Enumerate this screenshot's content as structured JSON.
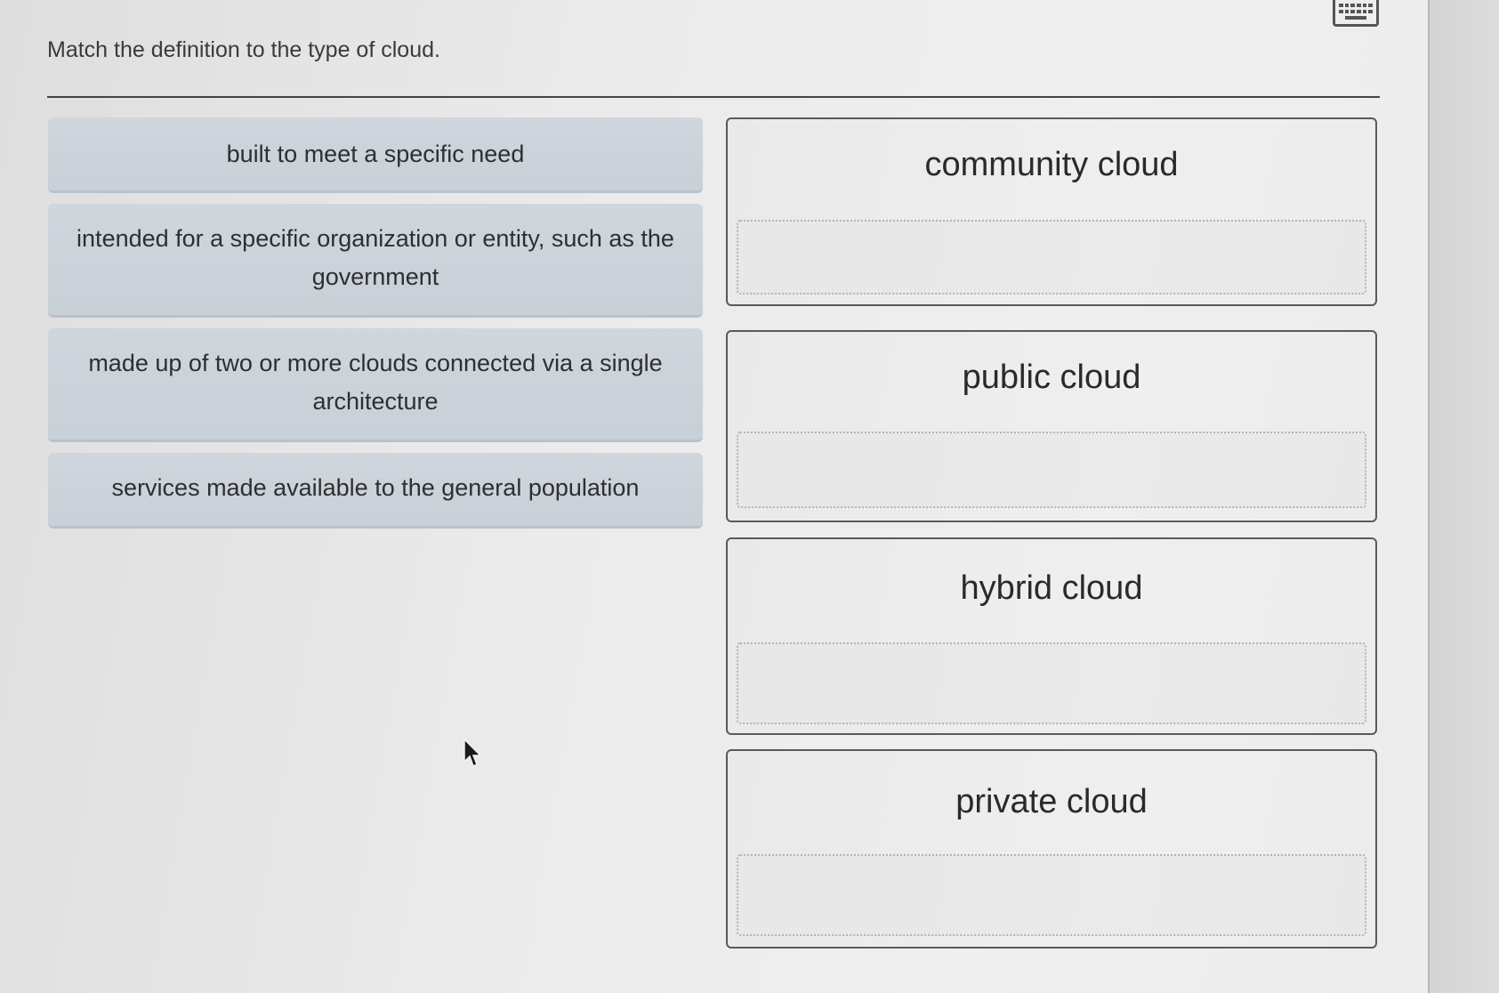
{
  "prompt": "Match the definition to the type of cloud.",
  "icons": {
    "keyboard": "keyboard-icon",
    "cursor": "mouse-pointer-icon"
  },
  "definitions": [
    "built to meet a specific need",
    "intended for a specific organization or entity, such as the government",
    "made up of two or more clouds connected via a single architecture",
    "services made available to the general population"
  ],
  "targets": [
    "community cloud",
    "public cloud",
    "hybrid cloud",
    "private cloud"
  ],
  "colors": {
    "source_bg": "#cbd3db",
    "target_border": "#5a5a5a",
    "text": "#2e2e2e"
  }
}
